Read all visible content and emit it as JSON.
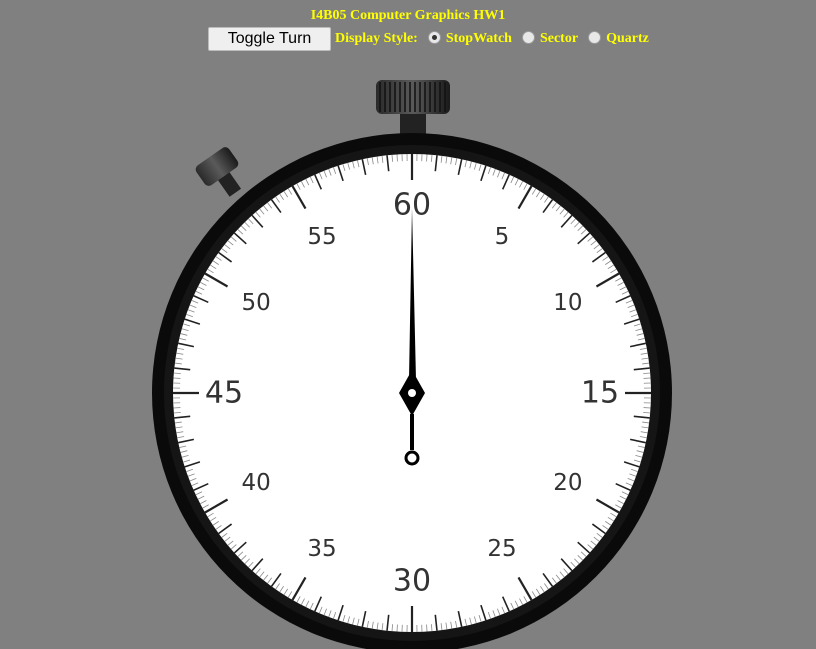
{
  "header": {
    "title": "I4B05 Computer Graphics HW1"
  },
  "controls": {
    "toggle_label": "Toggle Turn",
    "display_style_label": "Display Style:",
    "options": [
      {
        "label": "StopWatch",
        "checked": true
      },
      {
        "label": "Sector",
        "checked": false
      },
      {
        "label": "Quartz",
        "checked": false
      }
    ]
  },
  "dial": {
    "numbers": [
      "60",
      "5",
      "10",
      "15",
      "20",
      "25",
      "30",
      "35",
      "40",
      "45",
      "50",
      "55"
    ],
    "hand_seconds": 0
  },
  "colors": {
    "background": "#808080",
    "title": "#ffff00",
    "bezel": "#0a0a0a",
    "face": "#ffffff"
  }
}
